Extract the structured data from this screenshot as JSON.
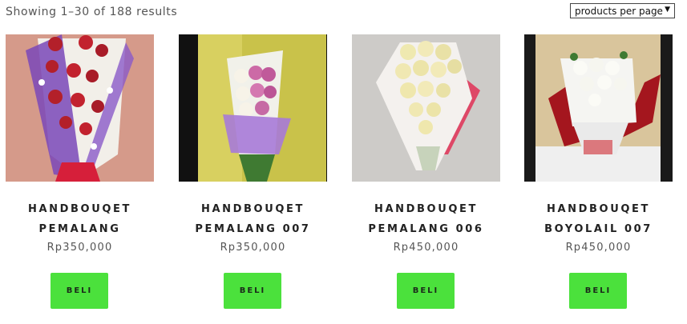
{
  "results": {
    "text": "Showing 1–30 of 188 results"
  },
  "per_page": {
    "selected": "products per page"
  },
  "products": [
    {
      "title_line1": "HANDBOUQET",
      "title_line2": "PEMALANG",
      "price": "Rp350,000",
      "buy_label": "BELI"
    },
    {
      "title_line1": "HANDBOUQET",
      "title_line2": "PEMALANG 007",
      "price": "Rp350,000",
      "buy_label": "BELI"
    },
    {
      "title_line1": "HANDBOUQET",
      "title_line2": "PEMALANG 006",
      "price": "Rp450,000",
      "buy_label": "BELI"
    },
    {
      "title_line1": "HANDBOUQET",
      "title_line2": "BOYOLAIL 007",
      "price": "Rp450,000",
      "buy_label": "BELI"
    }
  ],
  "colors": {
    "buy_button": "#4be13c"
  }
}
